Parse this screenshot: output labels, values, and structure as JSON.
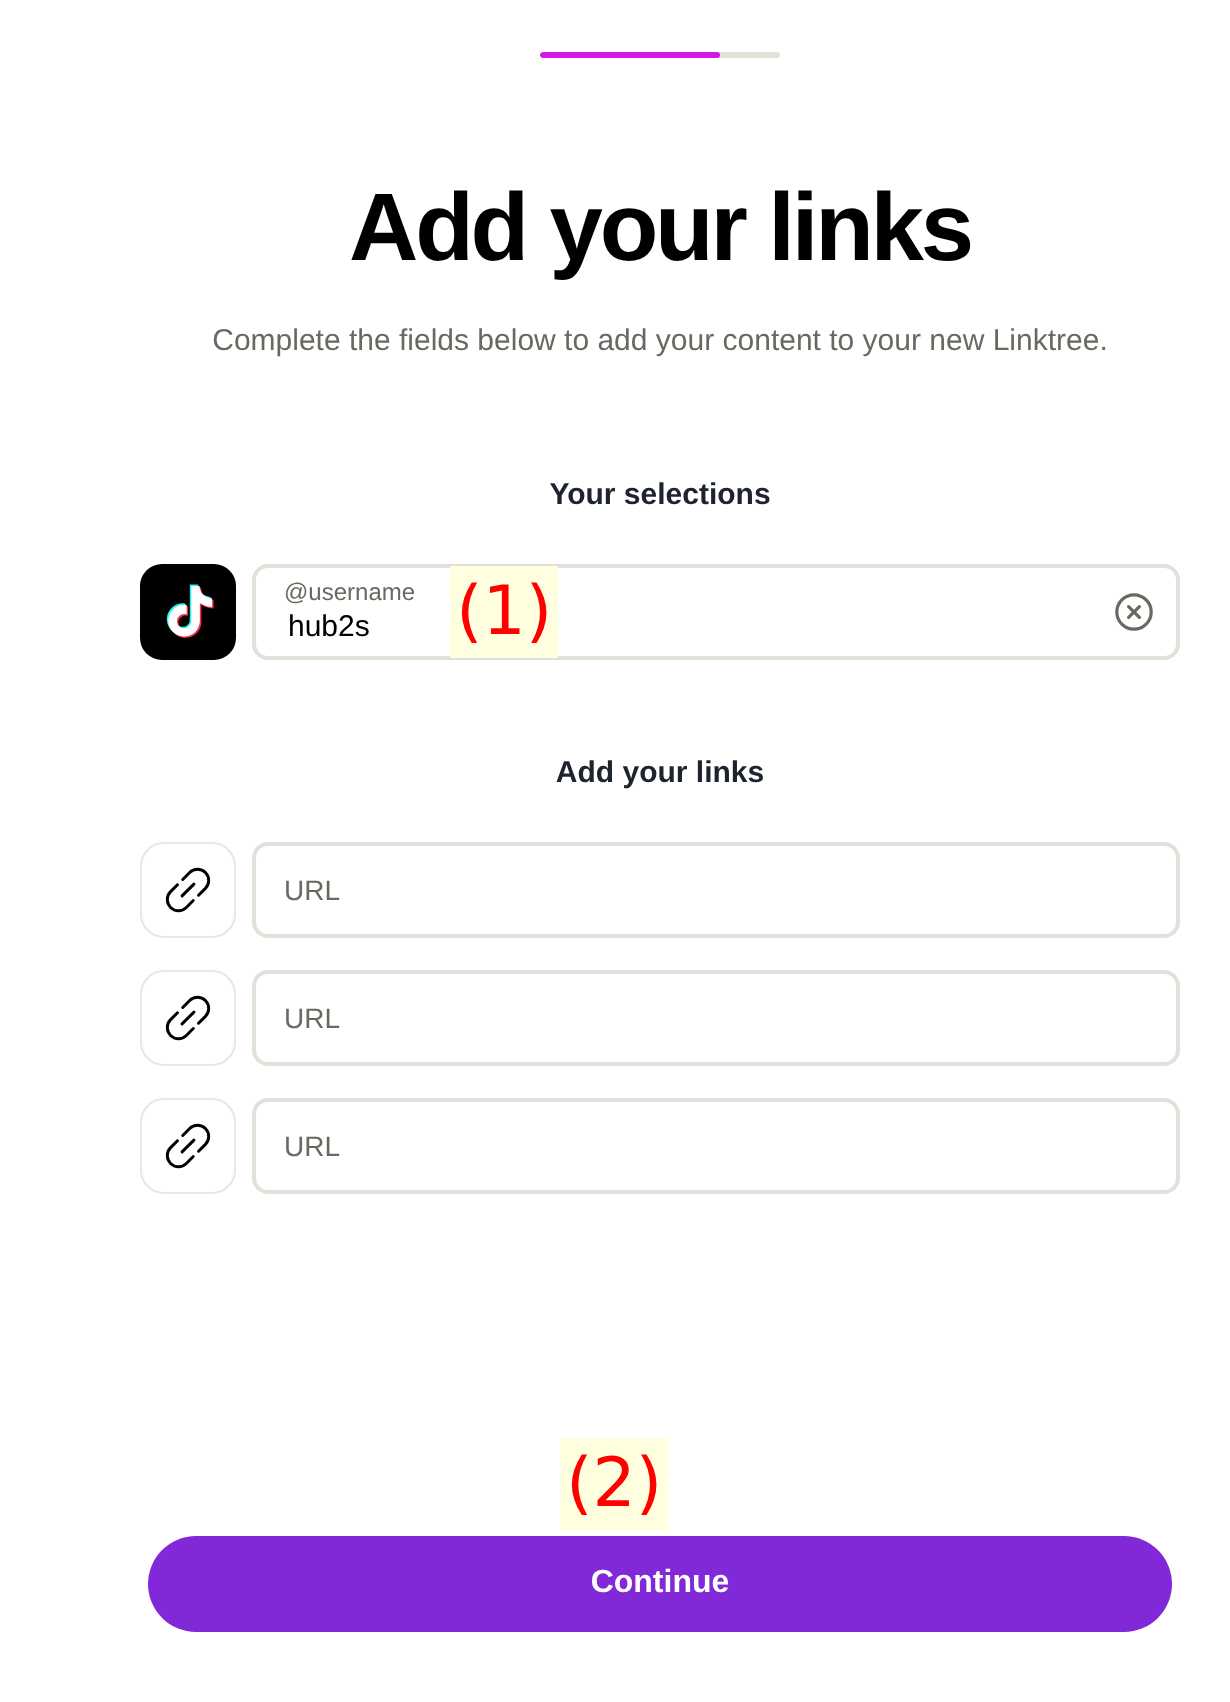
{
  "progress": {
    "level": 0.75
  },
  "title": "Add your links",
  "subtitle": "Complete the fields below to add your content to your new Linktree.",
  "selections": {
    "heading": "Your selections",
    "items": [
      {
        "label": "@username",
        "value": "hub2s"
      }
    ]
  },
  "links": {
    "heading": "Add your links",
    "fields": [
      {
        "placeholder": "URL"
      },
      {
        "placeholder": "URL"
      },
      {
        "placeholder": "URL"
      }
    ]
  },
  "continue_button": {
    "label": "Continue"
  },
  "annotations": [
    {
      "label": "(1)"
    },
    {
      "label": "(2)"
    }
  ]
}
